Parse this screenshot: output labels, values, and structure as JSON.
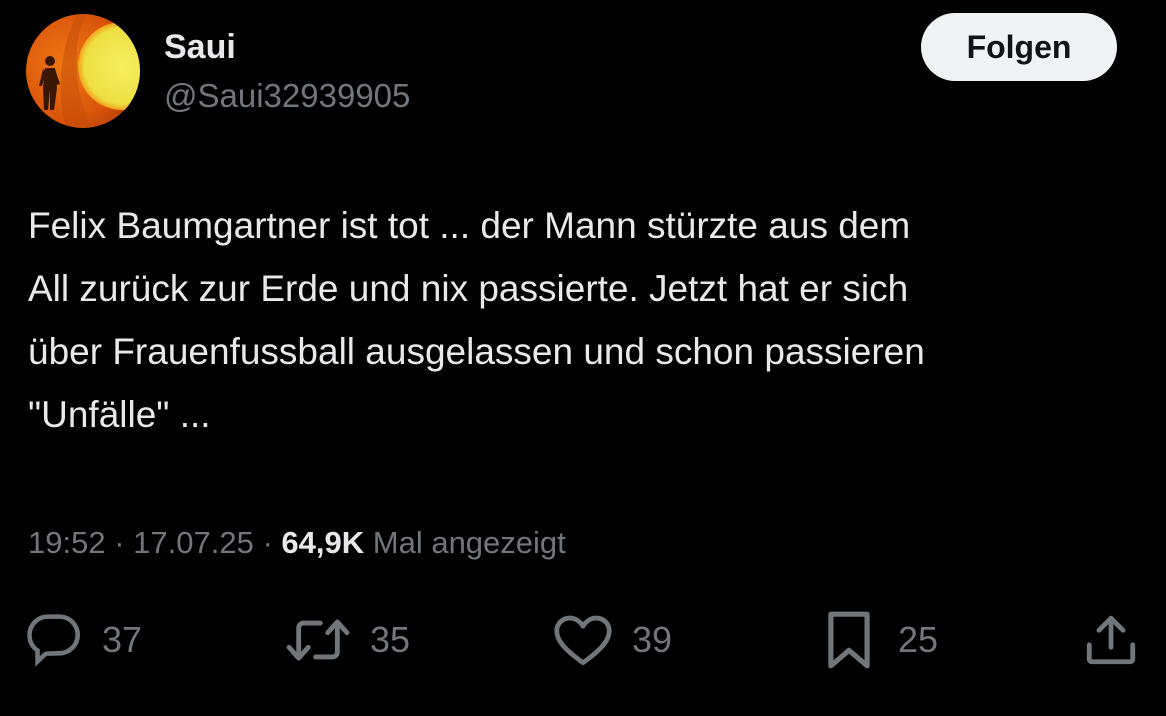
{
  "author": {
    "display_name": "Saui",
    "handle": "@Saui32939905"
  },
  "follow_button": {
    "label": "Folgen"
  },
  "tweet": {
    "text": "Felix Baumgartner ist tot ... der Mann stürzte aus dem\nAll zurück zur Erde und nix passierte. Jetzt hat er sich\nüber Frauenfussball ausgelassen und schon passieren\n\"Unfälle\" ...",
    "time": "19:52",
    "separator": "·",
    "date": "17.07.25",
    "views_count": "64,9K",
    "views_label": "Mal angezeigt"
  },
  "actions": {
    "replies": "37",
    "reposts": "35",
    "likes": "39",
    "bookmarks": "25"
  },
  "icons": {
    "reply": "reply-icon",
    "repost": "repost-icon",
    "like": "heart-icon",
    "bookmark": "bookmark-icon",
    "share": "share-icon"
  },
  "colors": {
    "background": "#000000",
    "primary_text": "#e7e9ea",
    "secondary_text": "#71767b",
    "button_bg": "#eff3f4",
    "button_text": "#0f1419"
  }
}
